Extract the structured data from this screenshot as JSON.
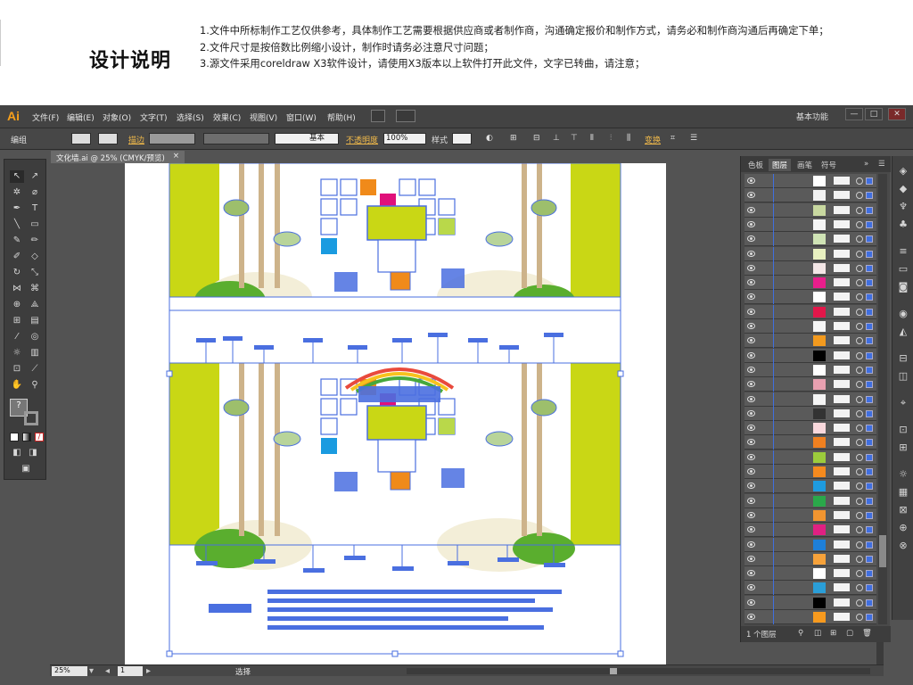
{
  "notes": {
    "title": "设计说明",
    "lines": [
      "1.文件中所标制作工艺仅供参考，具体制作工艺需要根据供应商或者制作商，沟通确定报价和制作方式，请务必和制作商沟通后再确定下单；",
      "2.文件尺寸是按倍数比例缩小设计，制作时请务必注意尺寸问题；",
      "3.源文件采用coreldraw X3软件设计，请使用X3版本以上软件打开此文件，文字已转曲，请注意；"
    ]
  },
  "app": {
    "logo": "Ai",
    "menu": [
      "文件(F)",
      "编辑(E)",
      "对象(O)",
      "文字(T)",
      "选择(S)",
      "效果(C)",
      "视图(V)",
      "窗口(W)",
      "帮助(H)"
    ],
    "workspace": "基本功能",
    "window_buttons": [
      "—",
      "□",
      "✕"
    ]
  },
  "control_bar": {
    "selection_type": "编组",
    "stroke_label": "描边",
    "stroke_style": "基本",
    "opacity_label": "不透明度",
    "opacity_value": "100%",
    "style_label": "样式",
    "transform_label": "变换"
  },
  "document": {
    "tab_title": "文化墙.ai @ 25% (CMYK/预览)",
    "close": "×",
    "zoom": "25%",
    "page": "1",
    "status": "选择"
  },
  "layers_panel": {
    "tabs": [
      "色板",
      "图层",
      "画笔",
      "符号"
    ],
    "active_tab": "图层",
    "footer": "1 个图层",
    "row_count": 31,
    "thumb_colors": [
      "#ffffff",
      "#f2f2f2",
      "#c8d8a0",
      "#f5f5f5",
      "#cfe3b5",
      "#e8f0c0",
      "#f3e6e6",
      "#e91e8c",
      "#ffffff",
      "#e3174a",
      "#f5f5f5",
      "#f39a1e",
      "#000000",
      "#ffffff",
      "#e8a0b0",
      "#f5f5f5",
      "#333333",
      "#f9d8dc",
      "#f08020",
      "#9ccc3c",
      "#f58a1e",
      "#1e9be0",
      "#2aa84a",
      "#f29530",
      "#e02082",
      "#1e7fd8",
      "#f7a23a",
      "#ffffff",
      "#2a9ed8",
      "#000000",
      "#f79a1e"
    ]
  },
  "colors": {
    "yellow_green": "#c9d715",
    "selection_blue": "#4a6fe0",
    "orange": "#f08a1a",
    "magenta": "#e0107a",
    "blue": "#1a9be0",
    "green": "#5aae2e",
    "tree_tan": "#cdb38a"
  }
}
